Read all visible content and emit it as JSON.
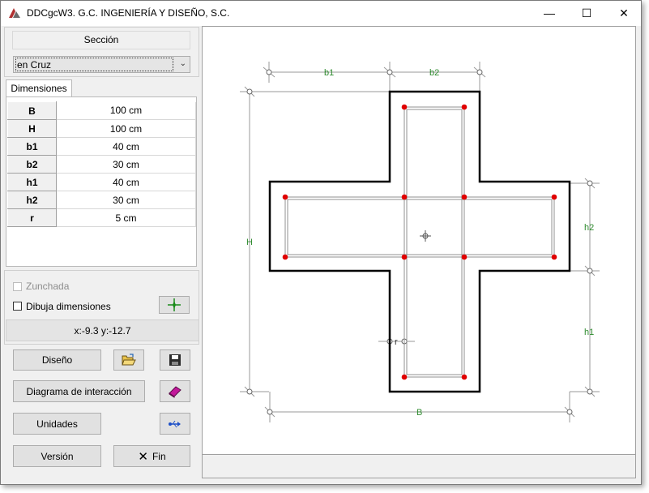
{
  "window": {
    "title": "DDCgcW3. G.C. INGENIERÍA Y DISEÑO, S.C.",
    "minimize_glyph": "—",
    "maximize_glyph": "☐",
    "close_glyph": "✕"
  },
  "seccion": {
    "label": "Sección",
    "selected": "en Cruz"
  },
  "dimensiones": {
    "tab_label": "Dimensiones",
    "rows": [
      {
        "key": "B",
        "value": "100 cm"
      },
      {
        "key": "H",
        "value": "100 cm"
      },
      {
        "key": "b1",
        "value": "40 cm"
      },
      {
        "key": "b2",
        "value": "30 cm"
      },
      {
        "key": "h1",
        "value": "40 cm"
      },
      {
        "key": "h2",
        "value": "30 cm"
      },
      {
        "key": "r",
        "value": "5 cm"
      }
    ]
  },
  "options": {
    "zunchada_label": "Zunchada",
    "zunchada_checked": false,
    "zunchada_enabled": false,
    "dibuja_label": "Dibuja dimensiones",
    "dibuja_checked": false
  },
  "coords": "x:-9.3 y:-12.7",
  "buttons": {
    "diseno": "Diseño",
    "diagrama": "Diagrama de interacción",
    "unidades": "Unidades",
    "version": "Versión",
    "fin": "Fin"
  },
  "icons": {
    "pick": "crosshair-pick-icon",
    "open": "folder-open-icon",
    "save": "floppy-disk-icon",
    "book": "book-icon",
    "units": "usb-arrows-icon",
    "fin": "x-icon"
  },
  "drawing": {
    "dim_labels": {
      "b1": "b1",
      "b2": "b2",
      "H": "H",
      "h2": "h2",
      "h1": "h1",
      "B": "B",
      "r": "r"
    },
    "colors": {
      "dim": "#2e8b2e",
      "outline": "#000000",
      "rebar": "#e00000",
      "stirrup": "#808080"
    }
  }
}
